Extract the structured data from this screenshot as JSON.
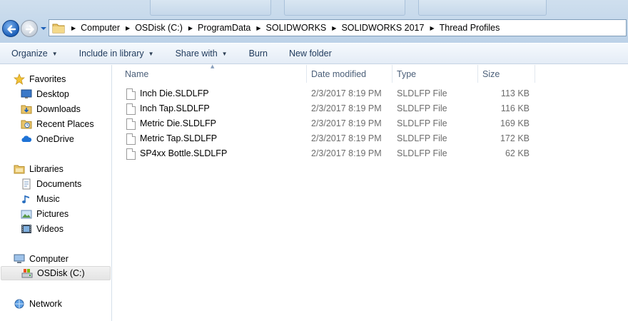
{
  "address_bar": {
    "crumbs": [
      "Computer",
      "OSDisk (C:)",
      "ProgramData",
      "SOLIDWORKS",
      "SOLIDWORKS 2017",
      "Thread Profiles"
    ]
  },
  "toolbar": {
    "organize": "Organize",
    "include_in_library": "Include in library",
    "share_with": "Share with",
    "burn": "Burn",
    "new_folder": "New folder"
  },
  "nav": {
    "favorites": "Favorites",
    "desktop": "Desktop",
    "downloads": "Downloads",
    "recent_places": "Recent Places",
    "onedrive": "OneDrive",
    "libraries": "Libraries",
    "documents": "Documents",
    "music": "Music",
    "pictures": "Pictures",
    "videos": "Videos",
    "computer": "Computer",
    "osdisk": "OSDisk (C:)",
    "network": "Network"
  },
  "columns": {
    "name": "Name",
    "date_modified": "Date modified",
    "type": "Type",
    "size": "Size"
  },
  "files": [
    {
      "name": "Inch Die.SLDLFP",
      "date": "2/3/2017 8:19 PM",
      "type": "SLDLFP File",
      "size": "113 KB"
    },
    {
      "name": "Inch Tap.SLDLFP",
      "date": "2/3/2017 8:19 PM",
      "type": "SLDLFP File",
      "size": "116 KB"
    },
    {
      "name": "Metric Die.SLDLFP",
      "date": "2/3/2017 8:19 PM",
      "type": "SLDLFP File",
      "size": "169 KB"
    },
    {
      "name": "Metric Tap.SLDLFP",
      "date": "2/3/2017 8:19 PM",
      "type": "SLDLFP File",
      "size": "172 KB"
    },
    {
      "name": "SP4xx Bottle.SLDLFP",
      "date": "2/3/2017 8:19 PM",
      "type": "SLDLFP File",
      "size": "62 KB"
    }
  ],
  "colors": {
    "toolbar_text": "#1e395b",
    "column_header_text": "#4c607a",
    "secondary_text": "#6d6d6d"
  }
}
